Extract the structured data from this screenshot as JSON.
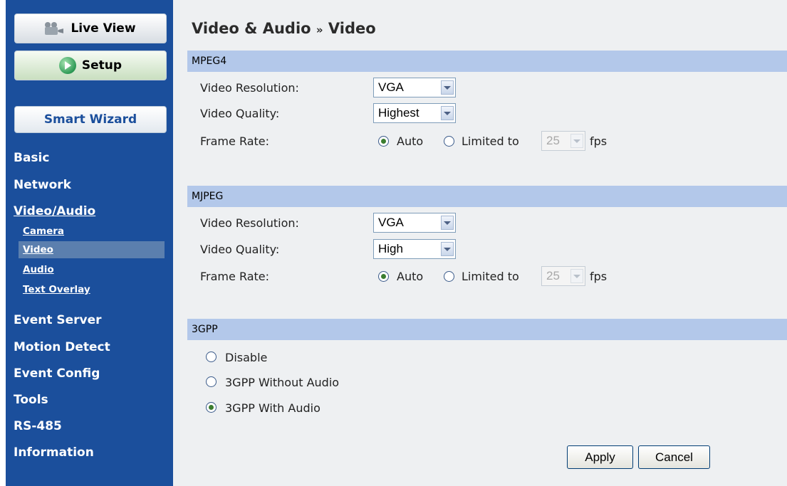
{
  "sidebar": {
    "live_view": "Live View",
    "setup": "Setup",
    "smart_wizard": "Smart Wizard",
    "nav": {
      "basic": "Basic",
      "network": "Network",
      "video_audio": "Video/Audio",
      "camera": "Camera",
      "video": "Video",
      "audio": "Audio",
      "text_overlay": "Text Overlay",
      "event_server": "Event Server",
      "motion_detect": "Motion Detect",
      "event_config": "Event Config",
      "tools": "Tools",
      "rs485": "RS-485",
      "information": "Information"
    }
  },
  "page": {
    "title_part1": "Video & Audio",
    "title_sep": "»",
    "title_part2": "Video"
  },
  "mpeg4": {
    "header": "MPEG4",
    "resolution_label": "Video Resolution:",
    "resolution_value": "VGA",
    "quality_label": "Video Quality:",
    "quality_value": "Highest",
    "framerate_label": "Frame Rate:",
    "auto_label": "Auto",
    "limited_label": "Limited to",
    "fps_value": "25",
    "fps_unit": "fps",
    "framerate_selected": "Auto"
  },
  "mjpeg": {
    "header": "MJPEG",
    "resolution_label": "Video Resolution:",
    "resolution_value": "VGA",
    "quality_label": "Video Quality:",
    "quality_value": "High",
    "framerate_label": "Frame Rate:",
    "auto_label": "Auto",
    "limited_label": "Limited to",
    "fps_value": "25",
    "fps_unit": "fps",
    "framerate_selected": "Auto"
  },
  "gpp": {
    "header": "3GPP",
    "opt_disable": "Disable",
    "opt_without_audio": "3GPP Without Audio",
    "opt_with_audio": "3GPP With Audio",
    "selected": "3GPP With Audio"
  },
  "actions": {
    "apply": "Apply",
    "cancel": "Cancel"
  },
  "colors": {
    "sidebar_bg": "#1b4f9c",
    "section_header_bg": "#b3c8ea",
    "main_bg": "#eef0f2"
  }
}
